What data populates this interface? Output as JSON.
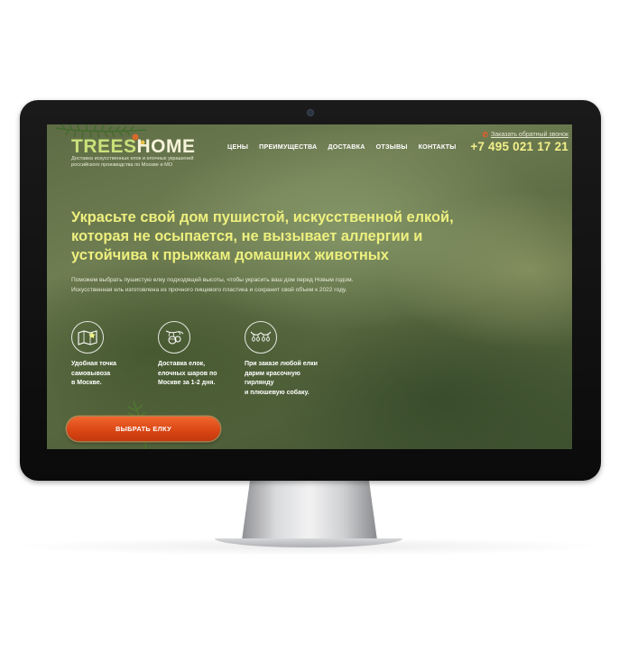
{
  "logo": {
    "part1": "TREES",
    "part2": "HOME",
    "tagline": "Доставка искусственных елок и елочных украшений российского производства по Москве и МО"
  },
  "nav": {
    "items": [
      "ЦЕНЫ",
      "ПРЕИМУЩЕСТВА",
      "ДОСТАВКА",
      "ОТЗЫВЫ",
      "КОНТАКТЫ"
    ]
  },
  "contact": {
    "callback_label": "Заказать обратный звонок",
    "phone": "+7 495 021 17 21"
  },
  "hero": {
    "headline": "Украсьте свой дом пушистой, искусственной елкой, которая не осыпается, не вызывает аллергии и устойчива к прыжкам домашних животных",
    "description_line1": "Поможем выбрать пушистую елку подходящей высоты, чтобы украсить ваш дом перед Новым годом.",
    "description_line2": "Искусственная ель изготовлена из прочного пищевого пластика и сохранит свой объем к 2022 году."
  },
  "features": [
    {
      "icon": "map-icon",
      "text": "Удобная точка\nсамовывоза\nв Москве."
    },
    {
      "icon": "ornaments-icon",
      "text": "Доставка елок,\nелочных шаров по\nМоскве за 1-2 дня."
    },
    {
      "icon": "garland-icon",
      "text": "При заказе любой елки\nдарим красочную гирлянду\nи плюшевую собаку."
    }
  ],
  "cta": {
    "label": "ВЫБРАТЬ ЕЛКУ"
  },
  "colors": {
    "accent_yellow": "#eef07e",
    "cta_orange": "#d94413",
    "logo_green": "#c9e07a"
  }
}
